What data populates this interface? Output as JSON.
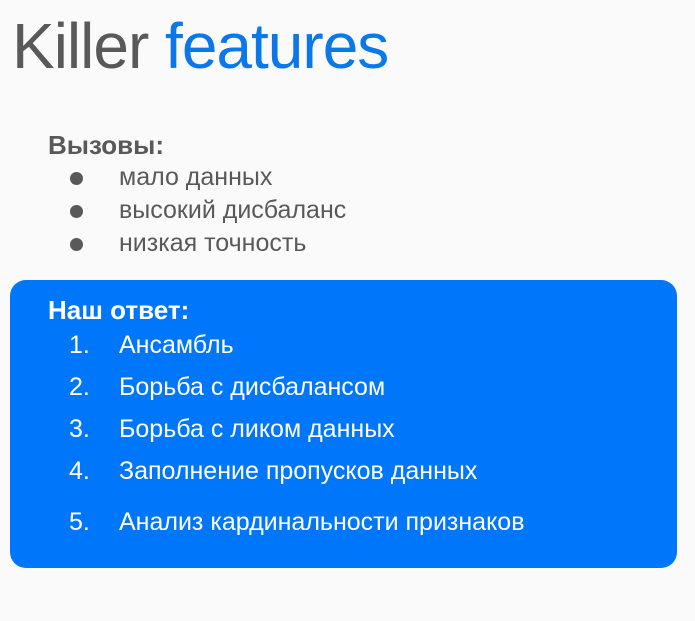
{
  "title": {
    "word1": "Killer",
    "word2": "features",
    "color_gray": "#595959",
    "color_accent": "#0a78ea"
  },
  "challenges": {
    "heading": "Вызовы:",
    "items": [
      "мало данных",
      "высокий дисбаланс",
      "низкая точность"
    ]
  },
  "answer": {
    "heading": "Наш ответ:",
    "box_color": "#0077fa",
    "items": [
      {
        "num": "1.",
        "text": "Ансамбль"
      },
      {
        "num": "2.",
        "text": "Борьба с дисбалансом"
      },
      {
        "num": "3.",
        "text": "Борьба с ликом данных"
      },
      {
        "num": "4.",
        "text": "Заполнение пропусков данных"
      },
      {
        "num": "5.",
        "text": "Анализ кардинальности признаков"
      }
    ]
  }
}
